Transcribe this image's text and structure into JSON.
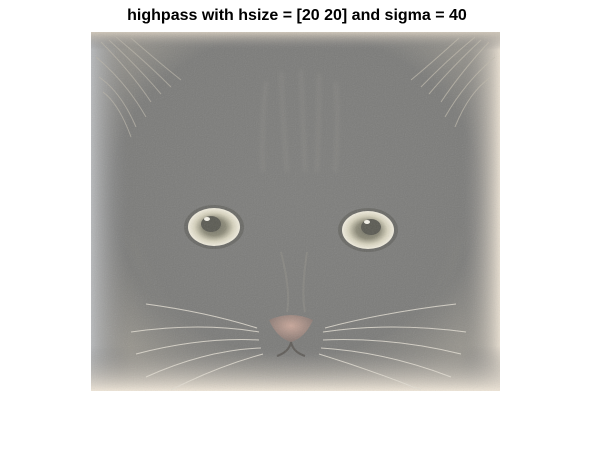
{
  "figure": {
    "title": "highpass with hsize = [20 20] and sigma = 40"
  },
  "image": {
    "subject": "kitten face",
    "filter": "highpass",
    "base_color": "#7b7b7b",
    "edge_tint": "#d8cfc2",
    "eye_color": "#e6e0c8",
    "nose_color": "#b8998e"
  }
}
